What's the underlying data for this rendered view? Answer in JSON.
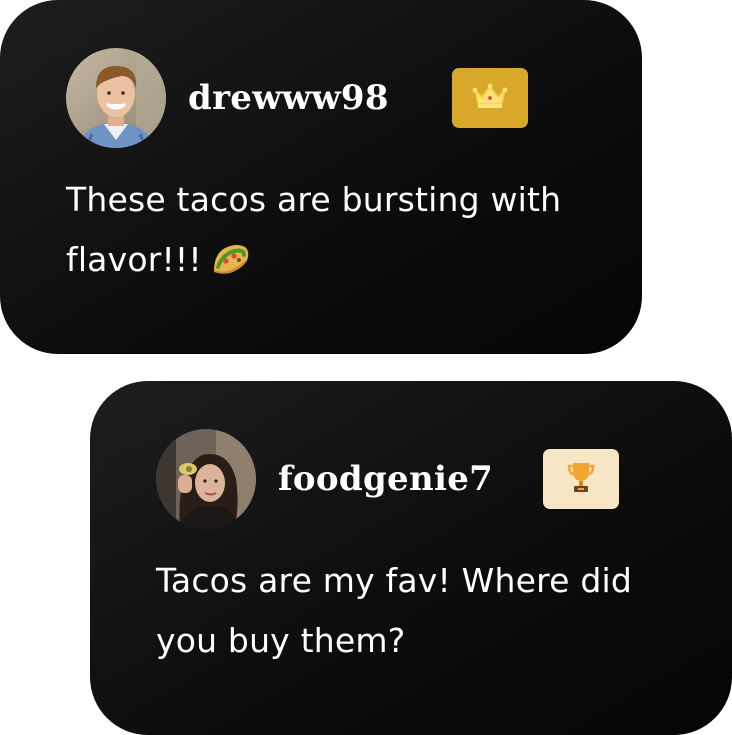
{
  "comments": [
    {
      "username": "drewww98",
      "badge_icon": "crown-icon",
      "badge_color": "#d9a82a",
      "message": "These tacos are bursting with flavor!!!",
      "emoji_icon": "taco-icon"
    },
    {
      "username": "foodgenie7",
      "badge_icon": "trophy-icon",
      "badge_color": "#f6e6c6",
      "message": "Tacos are my fav! Where did you buy them?"
    }
  ]
}
